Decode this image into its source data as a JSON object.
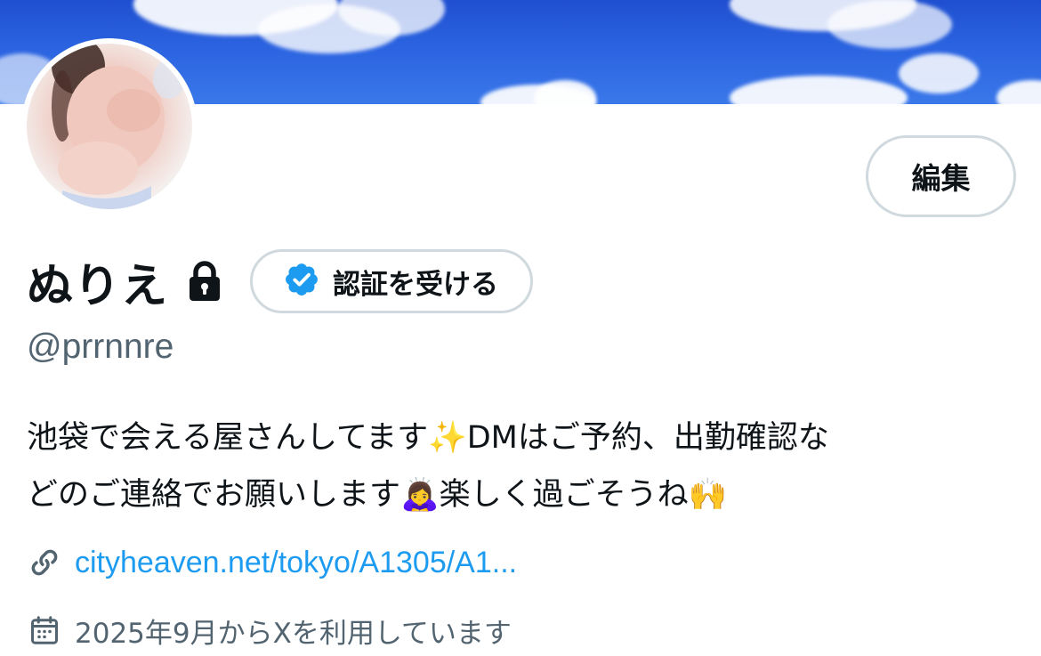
{
  "profile": {
    "display_name": "ぬりえ",
    "handle": "@prrnnre",
    "edit_label": "編集",
    "verify_label": "認証を受ける",
    "bio_line1": "池袋で会える屋さんしてます✨DMはご予約、出勤確認な",
    "bio_line2": "どのご連絡でお願いします🙇‍♀️楽しく過ごそうね🙌",
    "link": "cityheaven.net/tokyo/A1305/A1...",
    "joined": "2025年9月からXを利用しています"
  },
  "icons": {
    "lock": "lock-icon",
    "verified": "verified-badge-icon",
    "link": "link-icon",
    "calendar": "calendar-icon"
  },
  "colors": {
    "accent": "#1d9bf0",
    "secondary_text": "#536471",
    "border": "#cfd9de",
    "primary_text": "#0f1419"
  }
}
